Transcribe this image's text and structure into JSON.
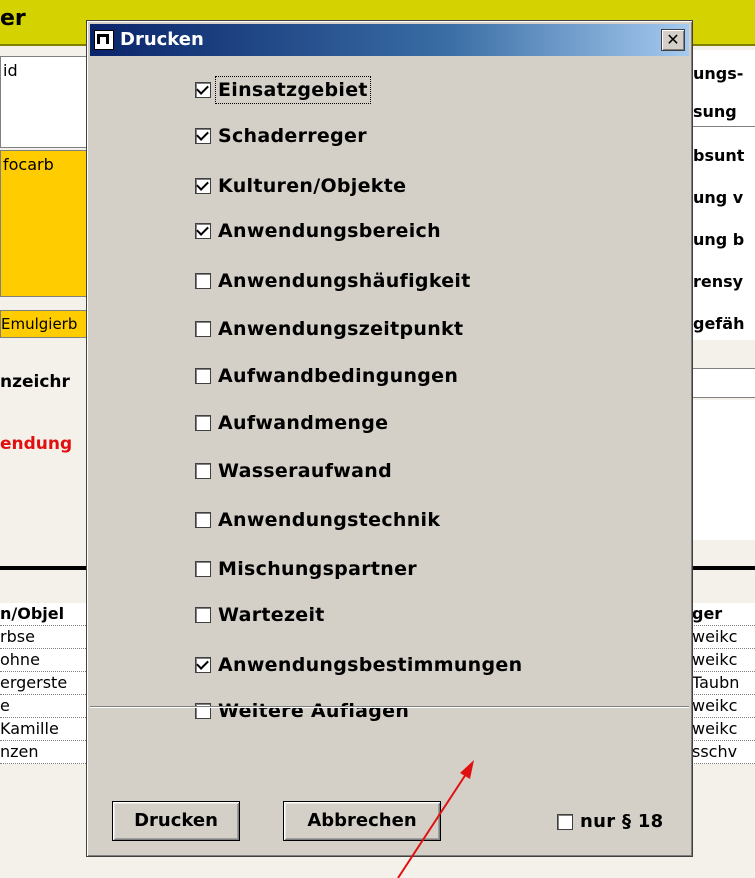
{
  "background": {
    "title_fragment": "er",
    "left": {
      "field1": "id",
      "field2": "focarb",
      "field3": "Emulgierb",
      "label1": "nzeichr",
      "label_red": "endung",
      "table_header": "n/Objel",
      "rows": [
        "rbse",
        "ohne",
        "ergerste",
        "e",
        "Kamille",
        "nzen"
      ]
    },
    "right": {
      "labels": [
        "ungs-",
        "sung",
        "bsunt",
        "ung v",
        "ung b",
        "rensy",
        "gefäh"
      ],
      "table_header": "ger",
      "rows": [
        "weikc",
        "weikc",
        "Taubn",
        "weikc",
        "weikc",
        "sschv"
      ]
    }
  },
  "dialog": {
    "title": "Drucken",
    "close_label": "✕",
    "options": [
      {
        "label": "Einsatzgebiet",
        "checked": true
      },
      {
        "label": "Schaderreger",
        "checked": true
      },
      {
        "label": "Kulturen/Objekte",
        "checked": true
      },
      {
        "label": "Anwendungsbereich",
        "checked": true
      },
      {
        "label": "Anwendungshäufigkeit",
        "checked": false
      },
      {
        "label": "Anwendungszeitpunkt",
        "checked": false
      },
      {
        "label": "Aufwandbedingungen",
        "checked": false
      },
      {
        "label": "Aufwandmenge",
        "checked": false
      },
      {
        "label": "Wasseraufwand",
        "checked": false
      },
      {
        "label": "Anwendungstechnik",
        "checked": false
      },
      {
        "label": "Mischungspartner",
        "checked": false
      },
      {
        "label": "Wartezeit",
        "checked": false
      },
      {
        "label": "Anwendungsbestimmungen",
        "checked": true
      },
      {
        "label": "Weitere Auflagen",
        "checked": false
      }
    ],
    "print_button": "Drucken",
    "cancel_button": "Abbrechen",
    "only18_label": "nur § 18",
    "only18_checked": false
  },
  "colors": {
    "title_bar": "#0a246a",
    "dialog_face": "#d4d0c8",
    "annotation_arrow": "#e01010",
    "header_bar": "#d4d200",
    "highlight_yellow": "#ffcc00"
  }
}
